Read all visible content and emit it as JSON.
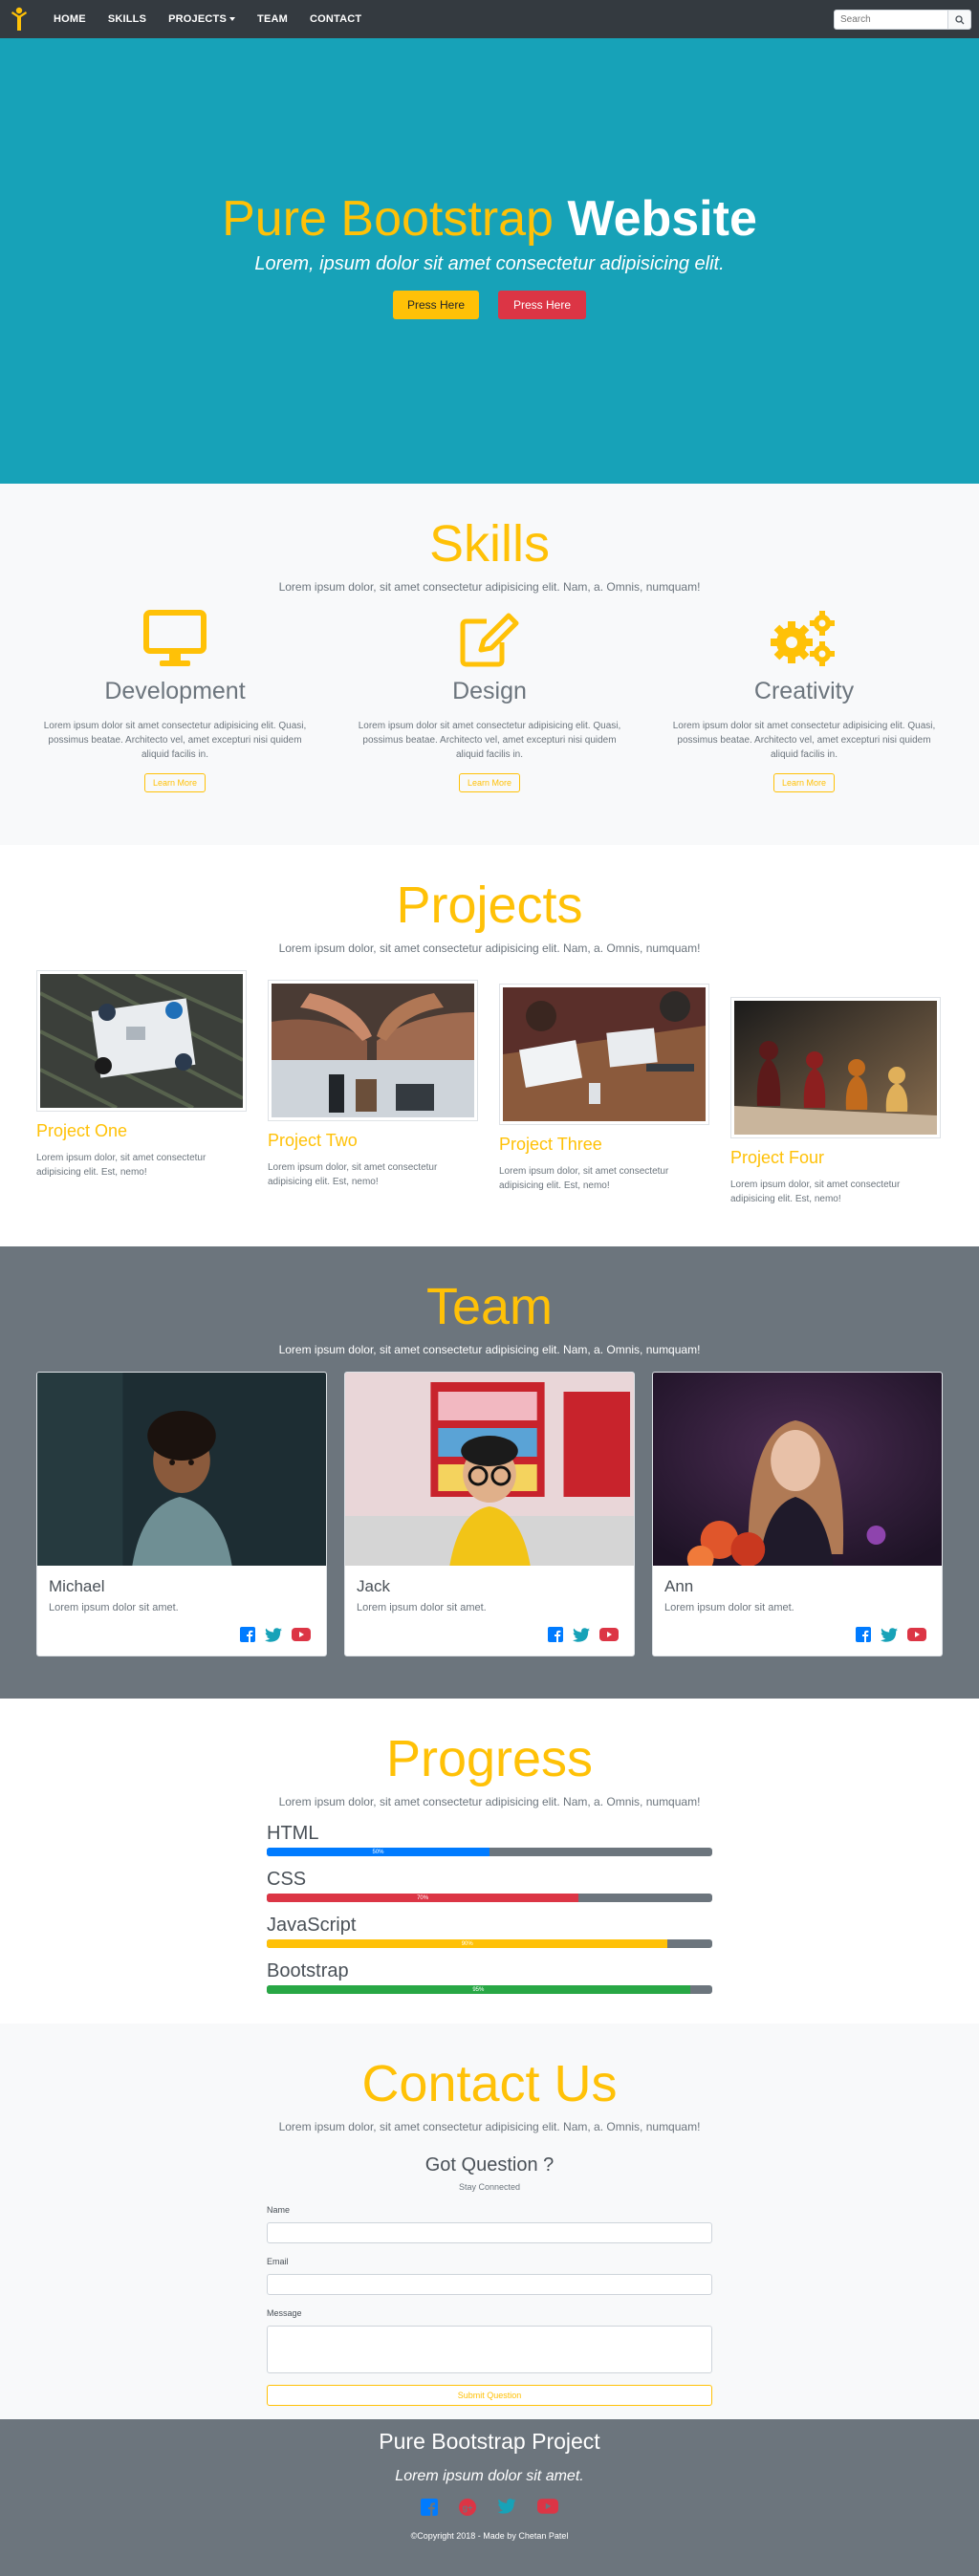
{
  "navbar": {
    "links": [
      {
        "label": "HOME"
      },
      {
        "label": "SKILLS"
      },
      {
        "label": "PROJECTS"
      },
      {
        "label": "TEAM"
      },
      {
        "label": "CONTACT"
      }
    ],
    "search_placeholder": "Search"
  },
  "hero": {
    "title_light": "Pure Bootstrap",
    "title_bold": "Website",
    "subtitle": "Lorem, ipsum dolor sit amet consectetur adipisicing elit.",
    "button1": "Press Here",
    "button2": "Press Here"
  },
  "skills": {
    "title": "Skills",
    "subtitle": "Lorem ipsum dolor, sit amet consectetur adipisicing elit. Nam, a. Omnis, numquam!",
    "items": [
      {
        "title": "Development",
        "icon": "desktop-icon",
        "text": "Lorem ipsum dolor sit amet consectetur adipisicing elit. Quasi, possimus beatae. Architecto vel, amet excepturi nisi quidem aliquid facilis in.",
        "button": "Learn More"
      },
      {
        "title": "Design",
        "icon": "edit-icon",
        "text": "Lorem ipsum dolor sit amet consectetur adipisicing elit. Quasi, possimus beatae. Architecto vel, amet excepturi nisi quidem aliquid facilis in.",
        "button": "Learn More"
      },
      {
        "title": "Creativity",
        "icon": "cogs-icon",
        "text": "Lorem ipsum dolor sit amet consectetur adipisicing elit. Quasi, possimus beatae. Architecto vel, amet excepturi nisi quidem aliquid facilis in.",
        "button": "Learn More"
      }
    ]
  },
  "projects": {
    "title": "Projects",
    "subtitle": "Lorem ipsum dolor, sit amet consectetur adipisicing elit. Nam, a. Omnis, numquam!",
    "items": [
      {
        "title": "Project One",
        "text": "Lorem ipsum dolor, sit amet consectetur adipisicing elit. Est, nemo!"
      },
      {
        "title": "Project Two",
        "text": "Lorem ipsum dolor, sit amet consectetur adipisicing elit. Est, nemo!"
      },
      {
        "title": "Project Three",
        "text": "Lorem ipsum dolor, sit amet consectetur adipisicing elit. Est, nemo!"
      },
      {
        "title": "Project Four",
        "text": "Lorem ipsum dolor, sit amet consectetur adipisicing elit. Est, nemo!"
      }
    ]
  },
  "team": {
    "title": "Team",
    "subtitle": "Lorem ipsum dolor, sit amet consectetur adipisicing elit. Nam, a. Omnis, numquam!",
    "members": [
      {
        "name": "Michael",
        "text": "Lorem ipsum dolor sit amet."
      },
      {
        "name": "Jack",
        "text": "Lorem ipsum dolor sit amet."
      },
      {
        "name": "Ann",
        "text": "Lorem ipsum dolor sit amet."
      }
    ]
  },
  "progress": {
    "title": "Progress",
    "subtitle": "Lorem ipsum dolor, sit amet consectetur adipisicing elit. Nam, a. Omnis, numquam!",
    "bars": [
      {
        "label": "HTML",
        "value": 50,
        "value_text": "50%",
        "color": "#007bff"
      },
      {
        "label": "CSS",
        "value": 70,
        "value_text": "70%",
        "color": "#dc3545"
      },
      {
        "label": "JavaScript",
        "value": 90,
        "value_text": "90%",
        "color": "#ffc107"
      },
      {
        "label": "Bootstrap",
        "value": 95,
        "value_text": "95%",
        "color": "#28a745"
      }
    ]
  },
  "contact": {
    "title": "Contact Us",
    "subtitle": "Lorem ipsum dolor, sit amet consectetur adipisicing elit. Nam, a. Omnis, numquam!",
    "form_title": "Got Question ?",
    "form_subtitle": "Stay Connected",
    "name_label": "Name",
    "email_label": "Email",
    "message_label": "Message",
    "submit": "Submit Question"
  },
  "footer": {
    "title": "Pure Bootstrap Project",
    "tagline": "Lorem ipsum dolor sit amet.",
    "copyright": "©Copyright 2018 - Made by Chetan Patel"
  },
  "colors": {
    "accent": "#ffc107",
    "hero_bg": "#17a2b8",
    "dark": "#343a40",
    "gray": "#6c757d"
  }
}
